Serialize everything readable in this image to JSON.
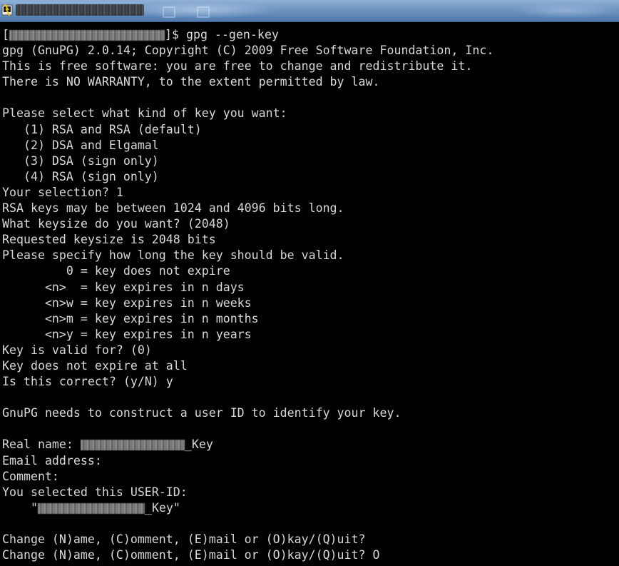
{
  "window": {
    "icon": "terminal-app-icon",
    "colors": {
      "titlebar": "#6f95c1",
      "background": "#000000",
      "text": "#d8d8d8"
    }
  },
  "terminal": {
    "prompt": {
      "suffix": "]$ gpg --gen-key"
    },
    "lines": [
      "gpg (GnuPG) 2.0.14; Copyright (C) 2009 Free Software Foundation, Inc.",
      "This is free software: you are free to change and redistribute it.",
      "There is NO WARRANTY, to the extent permitted by law.",
      "",
      "Please select what kind of key you want:",
      "   (1) RSA and RSA (default)",
      "   (2) DSA and Elgamal",
      "   (3) DSA (sign only)",
      "   (4) RSA (sign only)",
      "Your selection? 1",
      "RSA keys may be between 1024 and 4096 bits long.",
      "What keysize do you want? (2048)",
      "Requested keysize is 2048 bits",
      "Please specify how long the key should be valid.",
      "         0 = key does not expire",
      "      <n>  = key expires in n days",
      "      <n>w = key expires in n weeks",
      "      <n>m = key expires in n months",
      "      <n>y = key expires in n years",
      "Key is valid for? (0)",
      "Key does not expire at all",
      "Is this correct? (y/N) y",
      "",
      "GnuPG needs to construct a user ID to identify your key.",
      ""
    ],
    "real_name": {
      "label": "Real name: ",
      "suffix": "_Key"
    },
    "lines_after_name": [
      "Email address:",
      "Comment:",
      "You selected this USER-ID:"
    ],
    "user_id": {
      "prefix": "    \"",
      "suffix": "_Key\""
    },
    "final_lines": [
      "",
      "Change (N)ame, (C)omment, (E)mail or (O)kay/(Q)uit?",
      "Change (N)ame, (C)omment, (E)mail or (O)kay/(Q)uit? O"
    ]
  }
}
